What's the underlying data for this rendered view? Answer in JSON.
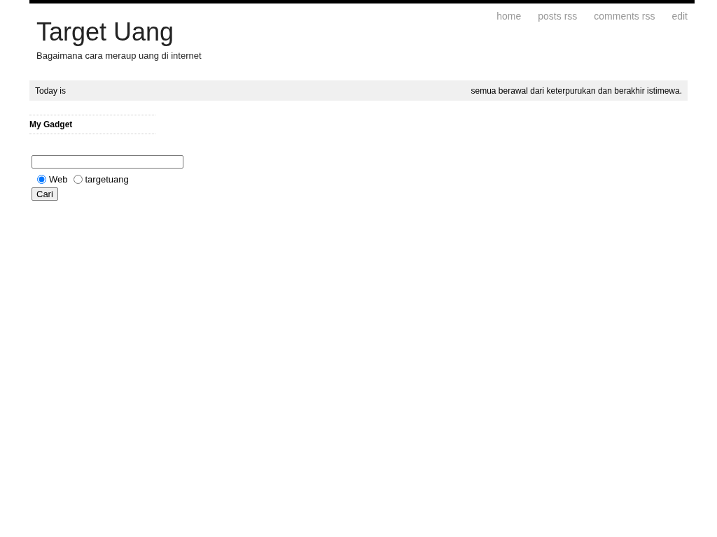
{
  "nav": [
    "home",
    "posts rss",
    "comments rss",
    "edit"
  ],
  "blog": {
    "title": "Target Uang",
    "description": "Bagaimana cara meraup uang di internet"
  },
  "info_bar": {
    "date_label": "Today is",
    "tagline": "semua berawal dari keterpurukan dan berakhir istimewa."
  },
  "sidebar": {
    "widget_title": "My Gadget",
    "search": {
      "options": [
        {
          "label": "Web",
          "selected": true
        },
        {
          "label": "targetuang",
          "selected": false
        }
      ],
      "button": "Cari"
    }
  }
}
